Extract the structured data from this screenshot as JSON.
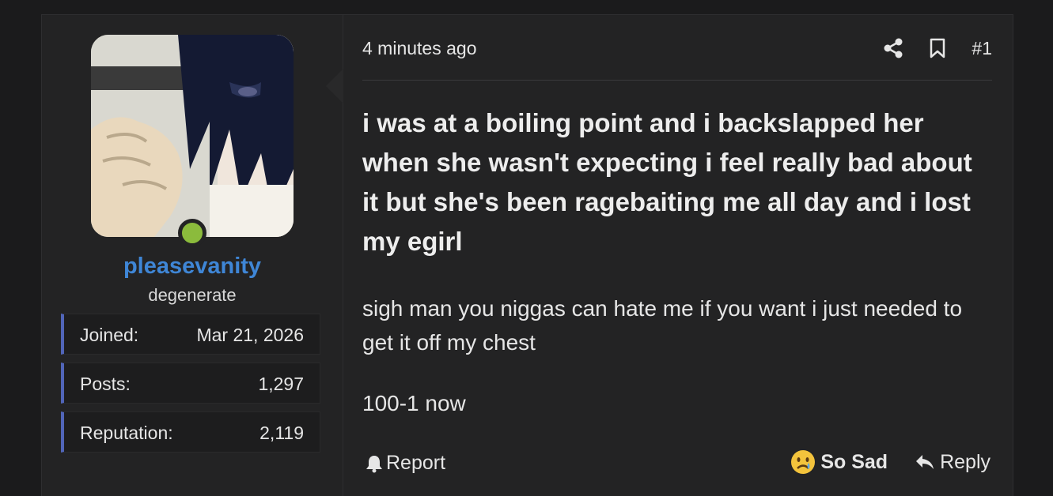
{
  "user": {
    "username": "pleasevanity",
    "title": "degenerate",
    "online": true,
    "stats": [
      {
        "label": "Joined:",
        "value": "Mar 21, 2026"
      },
      {
        "label": "Posts:",
        "value": "1,297"
      },
      {
        "label": "Reputation:",
        "value": "2,119"
      }
    ]
  },
  "post": {
    "time": "4 minutes ago",
    "number": "#1",
    "headline": "i was at a boiling point and i backslapped her when she wasn't expecting i feel really bad about it but she's been ragebaiting me all day and i lost my egirl",
    "body": "sigh man you niggas can hate me if you want i just needed to get it off my chest",
    "body2": "100-1 now",
    "icons": [
      "share-icon",
      "bookmark-icon"
    ]
  },
  "footer": {
    "report_label": "Report",
    "reaction_label": "So Sad",
    "reply_label": "Reply"
  },
  "colors": {
    "username": "#3f86d6",
    "online": "#8bbb3c",
    "stat_accent": "#5165b8"
  }
}
